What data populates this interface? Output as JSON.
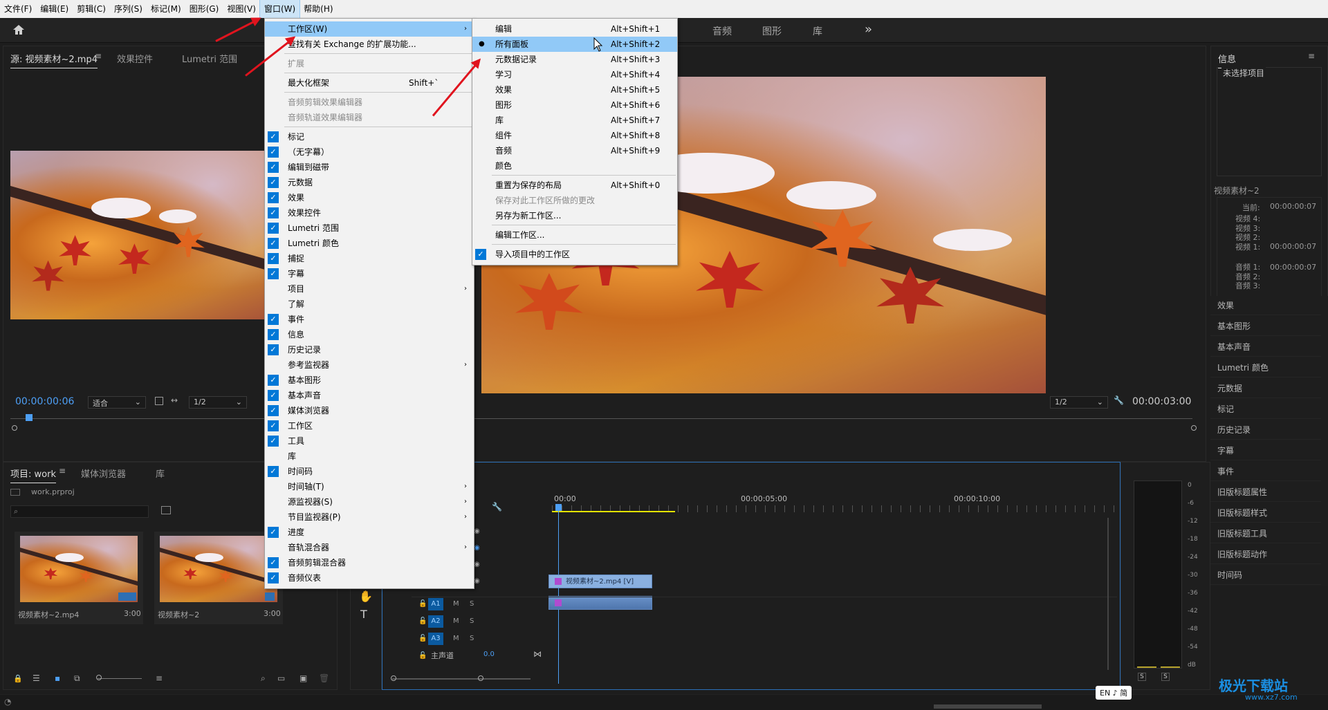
{
  "menubar": {
    "items": [
      "文件(F)",
      "编辑(E)",
      "剪辑(C)",
      "序列(S)",
      "标记(M)",
      "图形(G)",
      "视图(V)",
      "窗口(W)",
      "帮助(H)"
    ],
    "active": "窗口(W)"
  },
  "workspaces": {
    "audio": "音频",
    "graphics": "图形",
    "library": "库",
    "more": "»"
  },
  "source_panel": {
    "tabs": [
      "源: 视频素材~2.mp4",
      "效果控件",
      "Lumetri 范围"
    ],
    "timecode": "00:00:00:06",
    "fit": "适合",
    "resolution": "1/2"
  },
  "program_panel": {
    "resolution": "1/2",
    "timecode": "00:00:03:00"
  },
  "info_panel": {
    "title": "信息",
    "no_selection": "未选择项目",
    "clip_name": "视频素材~2",
    "current_label": "当前:",
    "current_value": "00:00:00:07",
    "video_lines": [
      "视频 4:",
      "视频 3:",
      "视频 2:",
      "视频 1:"
    ],
    "video1_value": "00:00:00:07",
    "audio_lines": [
      "音频 1:",
      "音频 2:",
      "音频 3:"
    ],
    "audio1_value": "00:00:00:07"
  },
  "right_panels": [
    "效果",
    "基本图形",
    "基本声音",
    "Lumetri 颜色",
    "元数据",
    "标记",
    "历史记录",
    "字幕",
    "事件",
    "旧版标题属性",
    "旧版标题样式",
    "旧版标题工具",
    "旧版标题动作",
    "时间码"
  ],
  "project_panel": {
    "tabs": [
      "项目: work",
      "媒体浏览器",
      "库"
    ],
    "project_file": "work.prproj",
    "items": [
      {
        "name": "视频素材~2.mp4",
        "duration": "3:00"
      },
      {
        "name": "视频素材~2",
        "duration": "3:00"
      }
    ]
  },
  "timeline": {
    "ruler": [
      "00:00",
      "00:00:05:00",
      "00:00:10:00"
    ],
    "clip_video": "视频素材~2.mp4 [V]",
    "audio_tracks": [
      "A1",
      "A2",
      "A3"
    ],
    "master_label": "主声道",
    "master_value": "0.0",
    "track_m": "M",
    "track_s": "S"
  },
  "meter_scale": [
    "0",
    "-6",
    "-12",
    "-18",
    "-24",
    "-30",
    "-36",
    "-42",
    "-48",
    "-54",
    "dB"
  ],
  "meter_buttons": [
    "S",
    "S"
  ],
  "window_menu": {
    "items": [
      {
        "label": "工作区(W)",
        "submenu": true,
        "highlight": true
      },
      {
        "label": "查找有关 Exchange 的扩展功能..."
      },
      {
        "label": "扩展",
        "disabled": true
      },
      {
        "label": "最大化框架",
        "shortcut": "Shift+`"
      },
      {
        "label": "音频剪辑效果编辑器",
        "disabled": true
      },
      {
        "label": "音频轨道效果编辑器",
        "disabled": true
      },
      {
        "label": "标记",
        "checked": true
      },
      {
        "label": "（无字幕）",
        "checked": true
      },
      {
        "label": "编辑到磁带",
        "checked": true
      },
      {
        "label": "元数据",
        "checked": true
      },
      {
        "label": "效果",
        "checked": true
      },
      {
        "label": "效果控件",
        "checked": true
      },
      {
        "label": "Lumetri 范围",
        "checked": true
      },
      {
        "label": "Lumetri 颜色",
        "checked": true
      },
      {
        "label": "捕捉",
        "checked": true
      },
      {
        "label": "字幕",
        "checked": true
      },
      {
        "label": "项目",
        "submenu": true
      },
      {
        "label": "了解"
      },
      {
        "label": "事件",
        "checked": true
      },
      {
        "label": "信息",
        "checked": true
      },
      {
        "label": "历史记录",
        "checked": true
      },
      {
        "label": "参考监视器",
        "submenu": true
      },
      {
        "label": "基本图形",
        "checked": true
      },
      {
        "label": "基本声音",
        "checked": true
      },
      {
        "label": "媒体浏览器",
        "checked": true
      },
      {
        "label": "工作区",
        "checked": true
      },
      {
        "label": "工具",
        "checked": true
      },
      {
        "label": "库"
      },
      {
        "label": "时间码",
        "checked": true
      },
      {
        "label": "时间轴(T)",
        "submenu": true
      },
      {
        "label": "源监视器(S)",
        "submenu": true
      },
      {
        "label": "节目监视器(P)",
        "submenu": true
      },
      {
        "label": "进度",
        "checked": true
      },
      {
        "label": "音轨混合器",
        "submenu": true
      },
      {
        "label": "音频剪辑混合器",
        "checked": true
      },
      {
        "label": "音频仪表",
        "checked": true
      }
    ]
  },
  "workspace_submenu": {
    "items": [
      {
        "label": "编辑",
        "shortcut": "Alt+Shift+1"
      },
      {
        "label": "所有面板",
        "shortcut": "Alt+Shift+2",
        "highlight": true,
        "bullet": true
      },
      {
        "label": "元数据记录",
        "shortcut": "Alt+Shift+3"
      },
      {
        "label": "学习",
        "shortcut": "Alt+Shift+4"
      },
      {
        "label": "效果",
        "shortcut": "Alt+Shift+5"
      },
      {
        "label": "图形",
        "shortcut": "Alt+Shift+6"
      },
      {
        "label": "库",
        "shortcut": "Alt+Shift+7"
      },
      {
        "label": "组件",
        "shortcut": "Alt+Shift+8"
      },
      {
        "label": "音频",
        "shortcut": "Alt+Shift+9"
      },
      {
        "label": "颜色"
      },
      {
        "label": "重置为保存的布局",
        "shortcut": "Alt+Shift+0"
      },
      {
        "label": "保存对此工作区所做的更改",
        "disabled": true
      },
      {
        "label": "另存为新工作区..."
      },
      {
        "label": "编辑工作区..."
      },
      {
        "label": "导入项目中的工作区",
        "checked": true
      }
    ]
  },
  "ime": "EN ♪ 简",
  "watermark": {
    "cn": "极光下载站",
    "url": "www.xz7.com"
  },
  "colors": {
    "accent_blue": "#0078d7",
    "menu_highlight": "#91c9f7",
    "timecode_blue": "#4d9ff5",
    "annotation_red": "#e0141e"
  }
}
